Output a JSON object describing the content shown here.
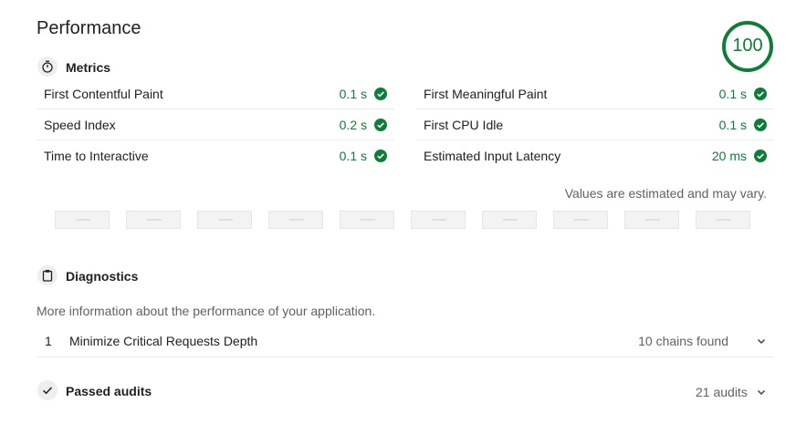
{
  "title": "Performance",
  "score": "100",
  "colors": {
    "pass": "#0f7d3a",
    "text": "#212121",
    "muted": "#616161"
  },
  "metrics": {
    "heading": "Metrics",
    "icon": "stopwatch-icon",
    "left": [
      {
        "label": "First Contentful Paint",
        "value": "0.1 s"
      },
      {
        "label": "Speed Index",
        "value": "0.2 s"
      },
      {
        "label": "Time to Interactive",
        "value": "0.1 s"
      }
    ],
    "right": [
      {
        "label": "First Meaningful Paint",
        "value": "0.1 s"
      },
      {
        "label": "First CPU Idle",
        "value": "0.1 s"
      },
      {
        "label": "Estimated Input Latency",
        "value": "20 ms"
      }
    ],
    "note": "Values are estimated and may vary."
  },
  "diagnostics": {
    "heading": "Diagnostics",
    "icon": "clipboard-icon",
    "description": "More information about the performance of your application.",
    "audits": [
      {
        "number": "1",
        "label": "Minimize Critical Requests Depth",
        "meta": "10 chains found"
      }
    ]
  },
  "passed": {
    "heading": "Passed audits",
    "icon": "checkmark-icon",
    "meta": "21 audits"
  }
}
